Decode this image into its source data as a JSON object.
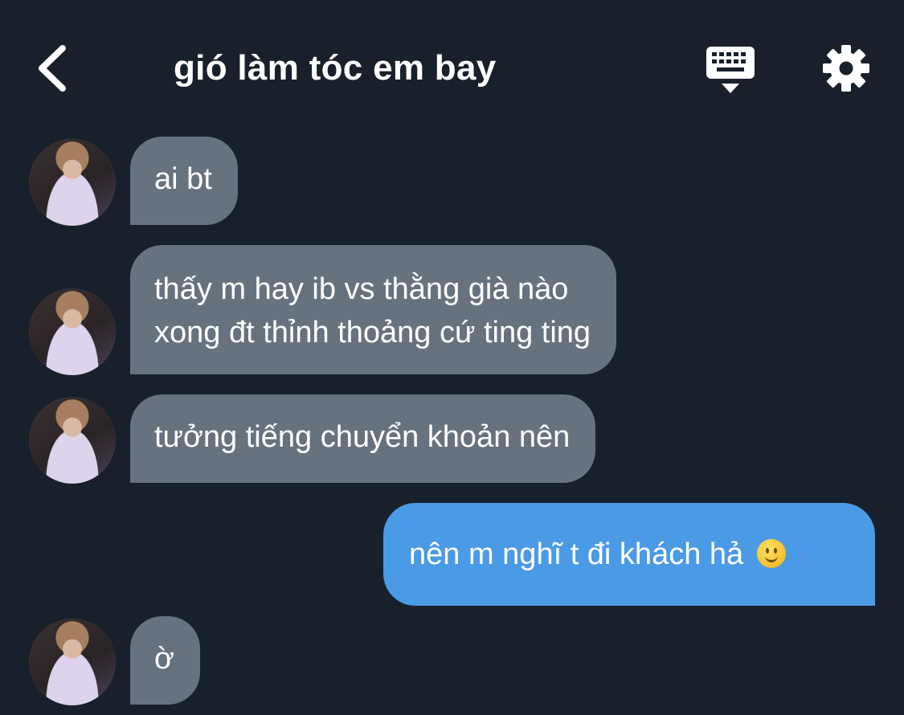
{
  "header": {
    "title": "gió làm tóc em bay",
    "back_icon": "chevron-left-icon",
    "keyboard_icon": "keyboard-icon",
    "settings_icon": "gear-icon"
  },
  "colors": {
    "background": "#18202b",
    "received_bubble": "#66737f",
    "sent_bubble": "#4a9ae6",
    "text": "#ffffff"
  },
  "messages": [
    {
      "direction": "received",
      "lines": [
        "ai bt"
      ]
    },
    {
      "direction": "received",
      "lines": [
        "thấy m hay ib vs thằng già nào",
        "xong đt thỉnh thoảng cứ ting ting"
      ]
    },
    {
      "direction": "received",
      "lines": [
        "tưởng tiếng chuyển khoản nên"
      ]
    },
    {
      "direction": "sent",
      "lines": [
        "nên m nghĩ t đi khách hả"
      ],
      "emoji": "slightly-smiling-face-icon"
    },
    {
      "direction": "received",
      "lines": [
        "ờ"
      ]
    }
  ]
}
